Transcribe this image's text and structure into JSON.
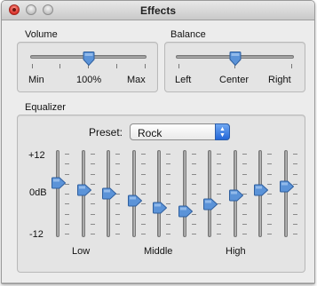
{
  "window": {
    "title": "Effects"
  },
  "volume": {
    "label": "Volume",
    "min_label": "Min",
    "value_label": "100%",
    "max_label": "Max",
    "level": 0.5
  },
  "balance": {
    "label": "Balance",
    "left_label": "Left",
    "center_label": "Center",
    "right_label": "Right",
    "level": 0.5
  },
  "equalizer": {
    "label": "Equalizer",
    "preset_label": "Preset:",
    "preset_value": "Rock",
    "scale_top": "+12",
    "scale_mid": "0dB",
    "scale_bottom": "-12",
    "low_label": "Low",
    "middle_label": "Middle",
    "high_label": "High",
    "bands_db": [
      3,
      1,
      0,
      -2,
      -4,
      -5,
      -3,
      -0.5,
      1,
      2
    ]
  },
  "colors": {
    "thumb": "#5b93d8",
    "accent": "#2467d8"
  }
}
